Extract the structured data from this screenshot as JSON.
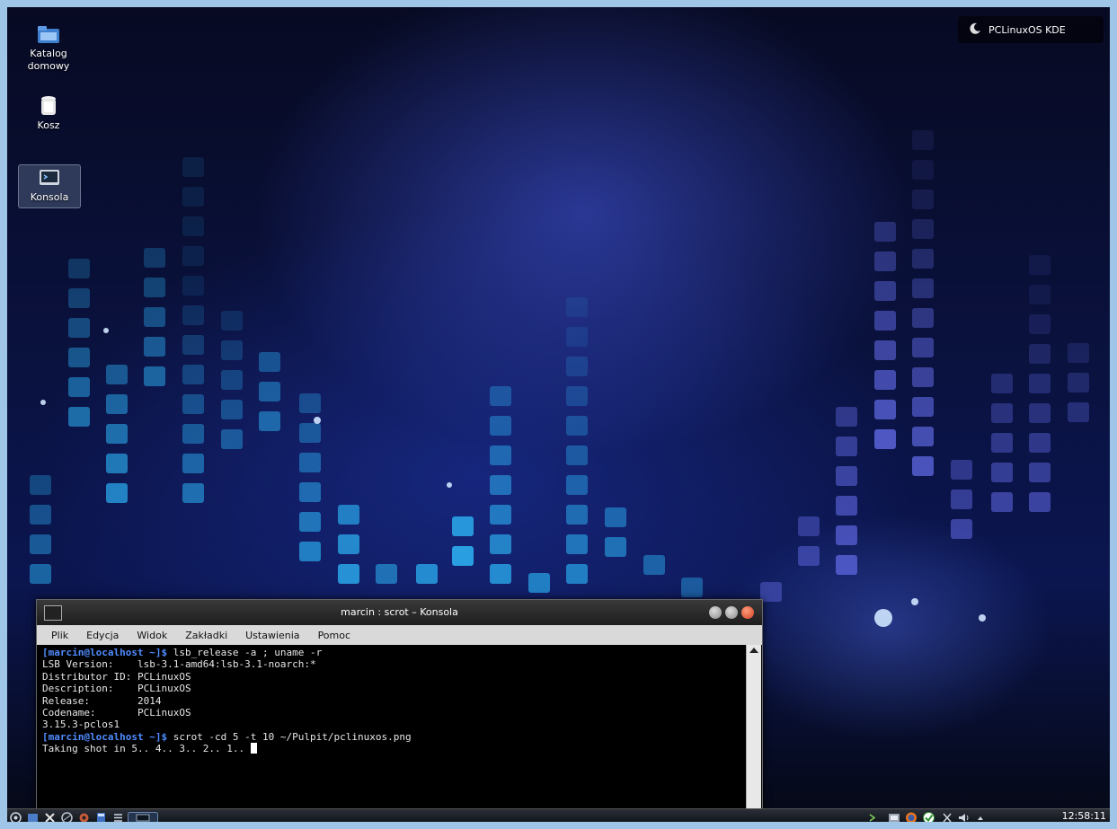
{
  "desktop": {
    "icons": [
      {
        "label": "Katalog\ndomowy",
        "icon": "folder-home-icon"
      },
      {
        "label": "Kosz",
        "icon": "trash-icon"
      },
      {
        "label": "Konsola",
        "icon": "terminal-icon"
      }
    ],
    "activity_label": "PCLinuxOS KDE"
  },
  "konsole": {
    "title": "marcin : scrot – Konsola",
    "menu": [
      "Plik",
      "Edycja",
      "Widok",
      "Zakładki",
      "Ustawienia",
      "Pomoc"
    ],
    "lines": [
      {
        "prompt": "[marcin@localhost ~]$",
        "text": " lsb_release -a ; uname -r"
      },
      {
        "prompt": "",
        "text": "LSB Version:    lsb-3.1-amd64:lsb-3.1-noarch:*"
      },
      {
        "prompt": "",
        "text": "Distributor ID: PCLinuxOS"
      },
      {
        "prompt": "",
        "text": "Description:    PCLinuxOS"
      },
      {
        "prompt": "",
        "text": "Release:        2014"
      },
      {
        "prompt": "",
        "text": "Codename:       PCLinuxOS"
      },
      {
        "prompt": "",
        "text": "3.15.3-pclos1"
      },
      {
        "prompt": "[marcin@localhost ~]$",
        "text": " scrot -cd 5 -t 10 ~/Pulpit/pclinuxos.png"
      },
      {
        "prompt": "",
        "text": "Taking shot in 5.. 4.. 3.. 2.. 1.. "
      }
    ]
  },
  "panel": {
    "clock": "12:58:11"
  },
  "colors": {
    "prompt": "#4f8cff",
    "tile_cyan": "#2aa6e8",
    "tile_violet": "#5a63d8",
    "close_button": "#e0553a"
  }
}
